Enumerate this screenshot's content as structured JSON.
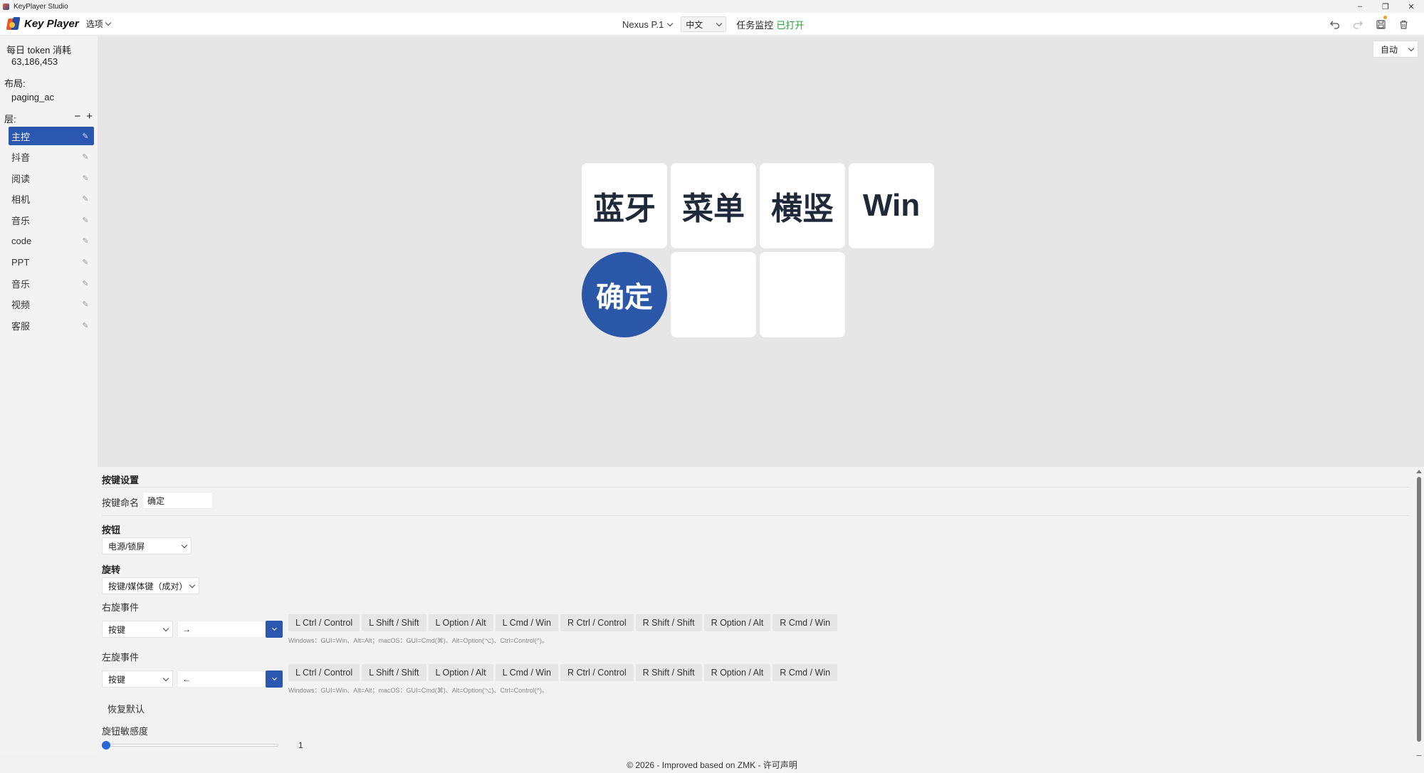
{
  "window": {
    "title": "KeyPlayer Studio",
    "controls": [
      "–",
      "❐",
      "✕"
    ]
  },
  "toolbar": {
    "logo_text": "Key Player",
    "options_label": "选项",
    "device_label": "Nexus P.1",
    "language": "中文",
    "monitor_label": "任务监控",
    "monitor_status": "已打开",
    "icons": [
      "undo-icon",
      "redo-icon",
      "save-icon",
      "trash-icon"
    ]
  },
  "sidebar": {
    "token_label": "每日 token 消耗",
    "token_value": "63,186,453",
    "layout_label": "布局:",
    "layout_value": "paging_ac",
    "layers_label": "层:",
    "layers": [
      {
        "label": "主控",
        "active": true
      },
      {
        "label": "抖音",
        "active": false
      },
      {
        "label": "阅读",
        "active": false
      },
      {
        "label": "相机",
        "active": false
      },
      {
        "label": "音乐",
        "active": false
      },
      {
        "label": "code",
        "active": false
      },
      {
        "label": "PPT",
        "active": false
      },
      {
        "label": "音乐",
        "active": false
      },
      {
        "label": "视频",
        "active": false
      },
      {
        "label": "客服",
        "active": false
      }
    ]
  },
  "canvas": {
    "mode": "自动",
    "keys": [
      "蓝牙",
      "菜单",
      "横竖",
      "Win",
      "确定",
      "",
      ""
    ]
  },
  "settings": {
    "section_title": "按键设置",
    "name_label": "按键命名",
    "name_value": "确定",
    "button_title": "按钮",
    "button_value": "电源/锁屏",
    "rotate_title": "旋转",
    "rotate_value": "按键/媒体键（成对）",
    "right_event_label": "右旋事件",
    "right_type": "按键",
    "right_key": "→",
    "left_event_label": "左旋事件",
    "left_type": "按键",
    "left_key": "←",
    "modifiers": [
      "L Ctrl / Control",
      "L Shift / Shift",
      "L Option / Alt",
      "L Cmd / Win",
      "R Ctrl / Control",
      "R Shift / Shift",
      "R Option / Alt",
      "R Cmd / Win"
    ],
    "modifier_hint": "Windows：GUI=Win、Alt=Alt；macOS：GUI=Cmd(⌘)、Alt=Option(⌥)、Ctrl=Control(^)。",
    "reset_label": "恢复默认",
    "sensitivity_label": "旋钮敏感度",
    "sensitivity_value": "1"
  },
  "footer": {
    "text": "© 2026 - Improved based on ZMK - 许可声明"
  },
  "colors": {
    "accent": "#2b57b0",
    "status_ok": "#2e9e3e",
    "round_key": "#2b57a8"
  }
}
